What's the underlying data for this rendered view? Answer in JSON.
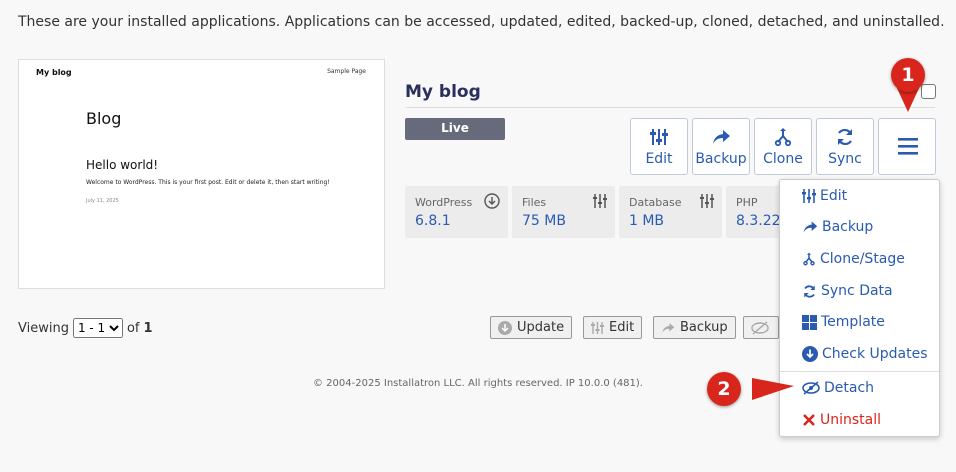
{
  "intro": "These are your installed applications. Applications can be accessed, updated, edited, backed-up, cloned, detached, and uninstalled.",
  "preview": {
    "site_name": "My blog",
    "sample_page": "Sample Page",
    "heading": "Blog",
    "post_title": "Hello world!",
    "post_text": "Welcome to WordPress. This is your first post. Edit or delete it, then start writing!",
    "post_date": "July 11, 2025"
  },
  "app": {
    "title": "My blog",
    "status": "Live"
  },
  "actions": {
    "edit": "Edit",
    "backup": "Backup",
    "clone": "Clone",
    "sync": "Sync"
  },
  "stats": [
    {
      "label": "WordPress",
      "value": "6.8.1"
    },
    {
      "label": "Files",
      "value": "75 MB"
    },
    {
      "label": "Database",
      "value": "1 MB"
    },
    {
      "label": "PHP",
      "value": "8.3.22"
    }
  ],
  "pagination": {
    "viewing_label": "Viewing",
    "selected": "1 - 1",
    "of_label": "of",
    "total": "1"
  },
  "bottom_actions": {
    "update": "Update",
    "edit": "Edit",
    "backup": "Backup"
  },
  "footer": "© 2004-2025 Installatron LLC. All rights reserved. IP 10.0.0 (481).",
  "menu": {
    "edit": "Edit",
    "backup": "Backup",
    "clone_stage": "Clone/Stage",
    "sync_data": "Sync Data",
    "template": "Template",
    "check_updates": "Check Updates",
    "detach": "Detach",
    "uninstall": "Uninstall"
  },
  "callouts": {
    "one": "1",
    "two": "2"
  },
  "colors": {
    "accent": "#2a5bb0",
    "title": "#2a2f5e",
    "danger": "#d9261c",
    "live": "#666a7a"
  }
}
